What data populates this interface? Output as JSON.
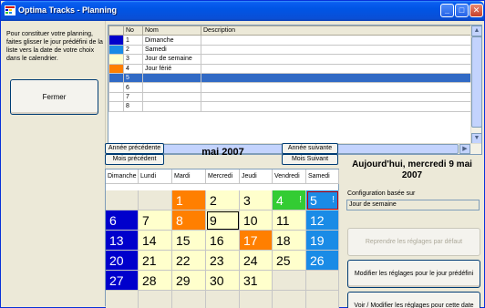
{
  "window": {
    "title": "Optima Tracks - Planning"
  },
  "left_panel": {
    "instructions": "Pour constituer votre planning, faites glisser le jour prédéfini de la liste vers la date de votre choix dans le calendrier.",
    "close_label": "Fermer"
  },
  "grid": {
    "headers": {
      "no": "No",
      "nom": "Nom",
      "description": "Description"
    },
    "rows": [
      {
        "no": "1",
        "nom": "Dimanche",
        "description": "",
        "color": "#0000cc"
      },
      {
        "no": "2",
        "nom": "Samedi",
        "description": "",
        "color": "#1a8be6"
      },
      {
        "no": "3",
        "nom": "Jour de semaine",
        "description": "",
        "color": "#ffffcc"
      },
      {
        "no": "4",
        "nom": "Jour férié",
        "description": "",
        "color": "#ff7f00"
      },
      {
        "no": "5",
        "nom": "",
        "description": "",
        "color": "#316ac5"
      },
      {
        "no": "6",
        "nom": "",
        "description": "",
        "color": "#ffffff"
      },
      {
        "no": "7",
        "nom": "",
        "description": "",
        "color": "#ffffff"
      },
      {
        "no": "8",
        "nom": "",
        "description": "",
        "color": "#ffffff"
      }
    ],
    "selected_row": 5
  },
  "calendar": {
    "prev_year": "Année précédente",
    "prev_month": "Mois précédent",
    "next_year": "Année suivante",
    "next_month": "Mois Suivant",
    "month_title": "mai 2007",
    "days": [
      "Dimanche",
      "Lundi",
      "Mardi",
      "Mercredi",
      "Jeudi",
      "Vendredi",
      "Samedi"
    ],
    "weeks": [
      [
        "",
        "",
        "1",
        "2",
        "3",
        "4",
        "5"
      ],
      [
        "6",
        "7",
        "8",
        "9",
        "10",
        "11",
        "12"
      ],
      [
        "13",
        "14",
        "15",
        "16",
        "17",
        "18",
        "19"
      ],
      [
        "20",
        "21",
        "22",
        "23",
        "24",
        "25",
        "26"
      ],
      [
        "27",
        "28",
        "29",
        "30",
        "31",
        "",
        ""
      ],
      [
        "",
        "",
        "",
        "",
        "",
        "",
        ""
      ]
    ],
    "marks": {
      "4": "!",
      "5": "!"
    }
  },
  "right_panel": {
    "today": "Aujourd'hui, mercredi 9 mai 2007",
    "config_label": "Configuration basée sur",
    "config_value": "Jour de semaine",
    "reset_label": "Reprendre les réglages par défaut",
    "modify_predef_label": "Modifier les réglages pour le jour prédéfini",
    "modify_date_label": "Voir / Modifier les réglages pour cette date"
  },
  "colors": {
    "sunday": "#0000cc",
    "saturday": "#1a8be6",
    "weekday": "#ffffcc",
    "holiday": "#ff7f00",
    "custom": "#33cc33",
    "selection": "#316ac5"
  }
}
